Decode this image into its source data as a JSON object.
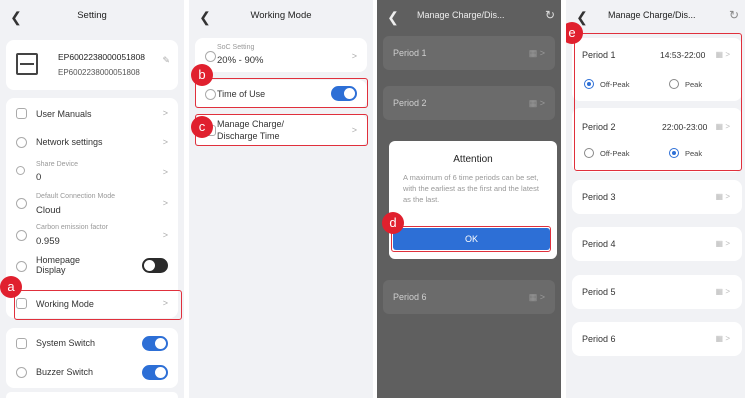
{
  "screen1": {
    "title": "Setting",
    "device": {
      "serial_top": "EP6002238000051808",
      "serial_bottom": "EP6002238000051808"
    },
    "items": {
      "user_manuals": "User Manuals",
      "network": "Network settings",
      "share_label": "Share Device",
      "share_value": "0",
      "conn_label": "Default Connection Mode",
      "conn_value": "Cloud",
      "carbon_label": "Carbon emission factor",
      "carbon_value": "0.959",
      "homepage": "Homepage Display",
      "working_mode": "Working Mode",
      "system_switch": "System Switch",
      "buzzer_switch": "Buzzer Switch"
    },
    "toggles": {
      "homepage": false,
      "system_switch": true,
      "buzzer_switch": true
    }
  },
  "screen2": {
    "title": "Working Mode",
    "soc_label": "SoC Setting",
    "soc_value": "20% - 90%",
    "time_of_use": "Time of Use",
    "time_of_use_on": true,
    "manage_line1": "Manage Charge/",
    "manage_line2": "Discharge Time"
  },
  "screen3": {
    "title": "Manage Charge/Dis...",
    "period1": "Period 1",
    "period2": "Period 2",
    "period6": "Period 6",
    "dialog_title": "Attention",
    "dialog_body": "A maximum of 6 time periods can be set, with the earliest as the first and the latest as the last.",
    "ok_label": "OK"
  },
  "screen4": {
    "title": "Manage Charge/Dis...",
    "periods": [
      {
        "label": "Period 1",
        "time": "14:53-22:00",
        "selected": "Off-Peak"
      },
      {
        "label": "Period 2",
        "time": "22:00-23:00",
        "selected": "Peak"
      }
    ],
    "off_peak": "Off-Peak",
    "peak": "Peak",
    "period3": "Period 3",
    "period4": "Period 4",
    "period5": "Period 5",
    "period6": "Period 6"
  },
  "markers": {
    "a": "a",
    "b": "b",
    "c": "c",
    "d": "d",
    "e": "e"
  },
  "colors": {
    "accent": "#2d6fd6",
    "highlight": "#e0303c"
  }
}
